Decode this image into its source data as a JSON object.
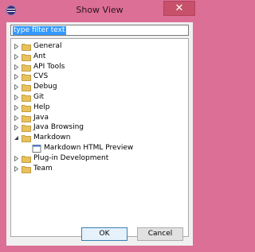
{
  "window": {
    "title": "Show View",
    "close_glyph": "✕"
  },
  "filter": {
    "value": "type filter text"
  },
  "tree": {
    "items": [
      {
        "label": "General",
        "expanded": false
      },
      {
        "label": "Ant",
        "expanded": false
      },
      {
        "label": "API Tools",
        "expanded": false
      },
      {
        "label": "CVS",
        "expanded": false
      },
      {
        "label": "Debug",
        "expanded": false
      },
      {
        "label": "Git",
        "expanded": false
      },
      {
        "label": "Help",
        "expanded": false
      },
      {
        "label": "Java",
        "expanded": false
      },
      {
        "label": "Java Browsing",
        "expanded": false
      },
      {
        "label": "Markdown",
        "expanded": true
      },
      {
        "label": "Markdown HTML Preview",
        "child": true
      },
      {
        "label": "Plug-in Development",
        "expanded": false
      },
      {
        "label": "Team",
        "expanded": false
      }
    ]
  },
  "buttons": {
    "ok_label": "OK",
    "cancel_label": "Cancel"
  },
  "colors": {
    "frame": "#dc6f95",
    "folder": "#e8c15b",
    "selection": "#3399ff"
  }
}
